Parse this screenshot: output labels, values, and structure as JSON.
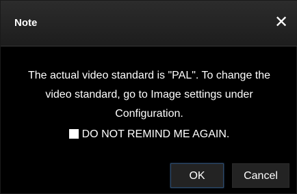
{
  "dialog": {
    "title": "Note",
    "close_icon": "close-icon",
    "message": "The actual video standard is \"PAL\". To change the video standard, go to Image settings under Configuration.",
    "remind_label": "DO NOT REMIND ME AGAIN.",
    "remind_checked": false,
    "ok_label": "OK",
    "cancel_label": "Cancel"
  }
}
